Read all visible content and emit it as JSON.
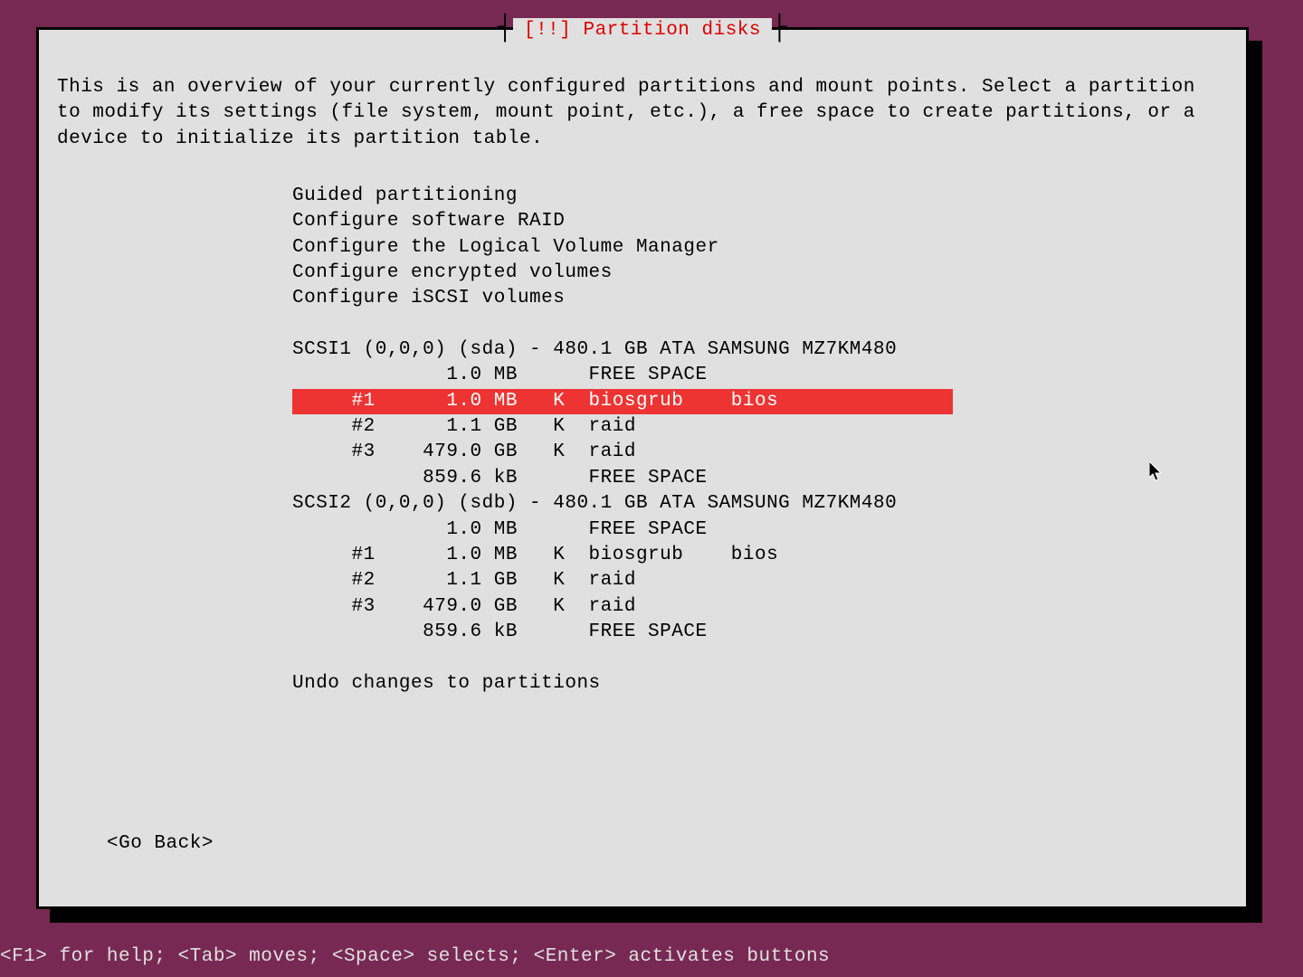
{
  "title": "[!!] Partition disks",
  "description": "This is an overview of your currently configured partitions and mount points. Select a partition to modify its settings (file system, mount point, etc.), a free space to create partitions, or a device to initialize its partition table.",
  "menu": {
    "guided": "Guided partitioning",
    "raid": "Configure software RAID",
    "lvm": "Configure the Logical Volume Manager",
    "encrypted": "Configure encrypted volumes",
    "iscsi": "Configure iSCSI volumes"
  },
  "disks": [
    {
      "header": "SCSI1 (0,0,0) (sda) - 480.1 GB ATA SAMSUNG MZ7KM480",
      "rows": [
        {
          "num": "  ",
          "size": "1.0 MB",
          "flag": " ",
          "fs": "FREE SPACE",
          "extra": ""
        },
        {
          "num": "#1",
          "size": "1.0 MB",
          "flag": "K",
          "fs": "biosgrub",
          "extra": "bios",
          "highlighted": true
        },
        {
          "num": "#2",
          "size": "1.1 GB",
          "flag": "K",
          "fs": "raid",
          "extra": ""
        },
        {
          "num": "#3",
          "size": "479.0 GB",
          "flag": "K",
          "fs": "raid",
          "extra": ""
        },
        {
          "num": "  ",
          "size": "859.6 kB",
          "flag": " ",
          "fs": "FREE SPACE",
          "extra": ""
        }
      ]
    },
    {
      "header": "SCSI2 (0,0,0) (sdb) - 480.1 GB ATA SAMSUNG MZ7KM480",
      "rows": [
        {
          "num": "  ",
          "size": "1.0 MB",
          "flag": " ",
          "fs": "FREE SPACE",
          "extra": ""
        },
        {
          "num": "#1",
          "size": "1.0 MB",
          "flag": "K",
          "fs": "biosgrub",
          "extra": "bios"
        },
        {
          "num": "#2",
          "size": "1.1 GB",
          "flag": "K",
          "fs": "raid",
          "extra": ""
        },
        {
          "num": "#3",
          "size": "479.0 GB",
          "flag": "K",
          "fs": "raid",
          "extra": ""
        },
        {
          "num": "  ",
          "size": "859.6 kB",
          "flag": " ",
          "fs": "FREE SPACE",
          "extra": ""
        }
      ]
    }
  ],
  "undo": "Undo changes to partitions",
  "goback": "<Go Back>",
  "footer": "<F1> for help; <Tab> moves; <Space> selects; <Enter> activates buttons"
}
